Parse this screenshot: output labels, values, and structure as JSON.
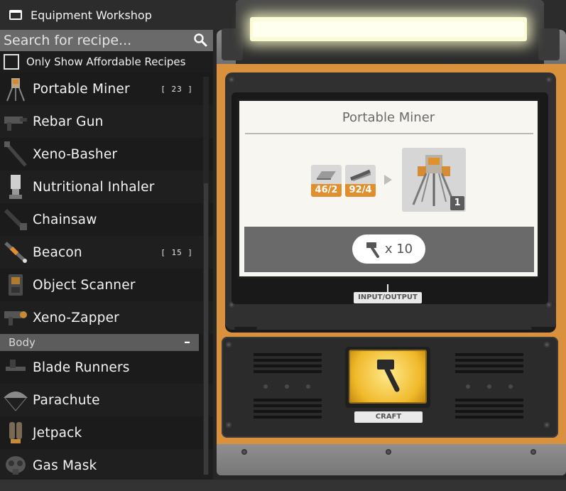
{
  "window": {
    "title": "Equipment Workshop",
    "icon": "window-icon"
  },
  "search": {
    "placeholder": "Search for recipe...",
    "icon": "magnifier-icon"
  },
  "filter": {
    "label": "Only Show Affordable Recipes",
    "checked": false
  },
  "recipes": [
    {
      "name": "Portable Miner",
      "count": "[ 23 ]",
      "icon": "portable-miner-icon"
    },
    {
      "name": "Rebar Gun",
      "count": "",
      "icon": "rebar-gun-icon"
    },
    {
      "name": "Xeno-Basher",
      "count": "",
      "icon": "xeno-basher-icon"
    },
    {
      "name": "Nutritional Inhaler",
      "count": "",
      "icon": "inhaler-icon"
    },
    {
      "name": "Chainsaw",
      "count": "",
      "icon": "chainsaw-icon"
    },
    {
      "name": "Beacon",
      "count": "[ 15 ]",
      "icon": "beacon-icon"
    },
    {
      "name": "Object Scanner",
      "count": "",
      "icon": "scanner-icon"
    },
    {
      "name": "Xeno-Zapper",
      "count": "",
      "icon": "xeno-zapper-icon"
    }
  ],
  "category": {
    "label": "Body",
    "toggle": "–"
  },
  "body_recipes": [
    {
      "name": "Blade Runners",
      "icon": "blade-runners-icon"
    },
    {
      "name": "Parachute",
      "icon": "parachute-icon"
    },
    {
      "name": "Jetpack",
      "icon": "jetpack-icon"
    },
    {
      "name": "Gas Mask",
      "icon": "gas-mask-icon"
    }
  ],
  "screen": {
    "title": "Portable Miner",
    "ingredients": [
      {
        "qty": "46/2",
        "icon": "iron-plate-icon"
      },
      {
        "qty": "92/4",
        "icon": "iron-rod-icon"
      }
    ],
    "product_count": "1",
    "product_icon": "portable-miner-icon",
    "craft_multiplier": "x 10",
    "io_label": "INPUT/OUTPUT"
  },
  "console": {
    "craft_label": "CRAFT",
    "button_icon": "hammer-icon"
  },
  "colors": {
    "orange": "#d9913e",
    "badge": "#e08f2e",
    "lamp": "#fbfbd8",
    "button": "#f0b92b"
  }
}
